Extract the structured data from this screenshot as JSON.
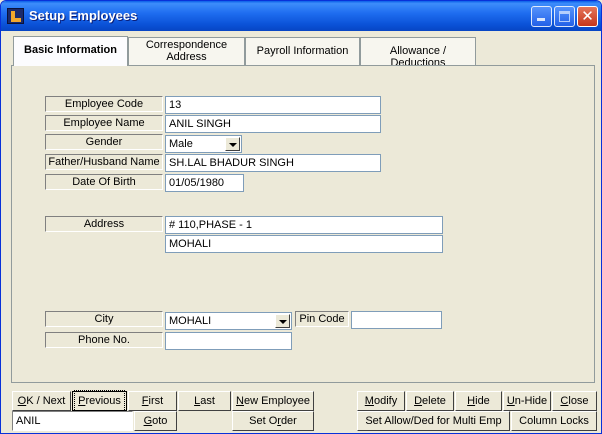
{
  "window": {
    "title": "Setup Employees",
    "controls": [
      "minimize-icon",
      "maximize-icon",
      "close-icon"
    ],
    "close_glyph": "✕"
  },
  "tabs": [
    {
      "label": "Basic Information",
      "active": true
    },
    {
      "label": "Correspondence Address",
      "active": false
    },
    {
      "label": "Payroll Information",
      "active": false
    },
    {
      "label": "Allowance / Deductions",
      "active": false
    }
  ],
  "form": {
    "employee_code": {
      "label": "Employee Code",
      "value": "13"
    },
    "employee_name": {
      "label": "Employee Name",
      "value": "ANIL SINGH"
    },
    "gender": {
      "label": "Gender",
      "value": "Male"
    },
    "father_husband_name": {
      "label": "Father/Husband Name",
      "value": "SH.LAL BHADUR SINGH"
    },
    "date_of_birth": {
      "label": "Date Of Birth",
      "value": "01/05/1980"
    },
    "address": {
      "label": "Address",
      "line1": "# 110,PHASE - 1",
      "line2": "MOHALI"
    },
    "city": {
      "label": "City",
      "value": "MOHALI"
    },
    "pin_code": {
      "label": "Pin Code",
      "value": ""
    },
    "phone_no": {
      "label": "Phone No.",
      "value": ""
    }
  },
  "buttons": {
    "ok_next": {
      "pre": "",
      "u": "O",
      "post": "K / Next"
    },
    "previous": {
      "pre": "",
      "u": "P",
      "post": "revious"
    },
    "first": {
      "pre": "",
      "u": "F",
      "post": "irst"
    },
    "last": {
      "pre": "",
      "u": "L",
      "post": "ast"
    },
    "new_employee": {
      "pre": "",
      "u": "N",
      "post": "ew Employee"
    },
    "modify": {
      "pre": "",
      "u": "M",
      "post": "odify"
    },
    "delete": {
      "pre": "",
      "u": "D",
      "post": "elete"
    },
    "hide": {
      "pre": "",
      "u": "H",
      "post": "ide"
    },
    "unhide": {
      "pre": "",
      "u": "U",
      "post": "n-Hide"
    },
    "close": {
      "pre": "",
      "u": "C",
      "post": "lose"
    },
    "goto": {
      "pre": "",
      "u": "G",
      "post": "oto"
    },
    "set_order": {
      "pre": "Set O",
      "u": "r",
      "post": "der"
    },
    "set_allow_ded": {
      "pre": "Set Allow/Ded for Multi Emp",
      "u": "",
      "post": ""
    },
    "column_locks": {
      "pre": "Column Locks",
      "u": "",
      "post": ""
    }
  },
  "search": {
    "value": "ANIL"
  }
}
